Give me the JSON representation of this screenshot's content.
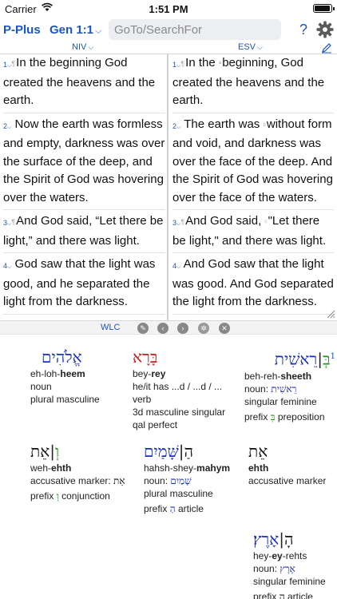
{
  "status": {
    "carrier": "Carrier",
    "time": "1:51 PM",
    "battery_level": 0.95
  },
  "toolbar": {
    "app_name": "P-Plus",
    "reference": "Gen 1:1",
    "search_placeholder": "GoTo/SearchFor",
    "help": "?"
  },
  "versions": {
    "left": "NIV",
    "right": "ESV"
  },
  "niv": [
    {
      "num": "1",
      "text": "In the beginning God created the heavens and the earth."
    },
    {
      "num": "2",
      "text": "Now the earth was formless and empty, darkness was over the surface of the deep, and the Spirit of God was hovering over the waters."
    },
    {
      "num": "3",
      "text": "And God said, “Let there be light,” and there was light."
    },
    {
      "num": "4",
      "text": "God saw that the light was good, and he separated the light from the darkness."
    }
  ],
  "esv": [
    {
      "num": "1",
      "text_a": "In the ",
      "text_b": "beginning, God created the heavens and the earth."
    },
    {
      "num": "2",
      "text_a": "The earth was ",
      "text_b": "without form and void, and darkness was over the face of the deep. And the Spirit of God was hovering over the face of the waters."
    },
    {
      "num": "3",
      "text_a": "And God said, ",
      "text_b": "\"Let there be light,\" and there was light."
    },
    {
      "num": "4",
      "text": "And God saw that the light was good. And God separated the light from the darkness."
    }
  ],
  "interlinear": {
    "version": "WLC",
    "words": [
      {
        "hebrew": "בְּ|רֵאשִׁית",
        "verse_num": "1",
        "translit_pre": "beh-reh-",
        "translit_bold": "sheeth",
        "noun_label": "noun: ",
        "noun_lemma": "רֵאשִׁית",
        "grammar": "singular feminine",
        "prefix_label": "prefix ",
        "prefix_letter": "בְּ",
        "prefix_gloss": "preposition"
      },
      {
        "hebrew": "בָּרָא",
        "translit_pre": "bey-",
        "translit_bold": "rey",
        "gloss": "he/it has ...d / ...d / ...",
        "pos": "verb",
        "grammar": "3d masculine singular",
        "stem": "qal perfect"
      },
      {
        "hebrew": "אֱלֹהִים",
        "translit_pre": "eh-loh-",
        "translit_bold": "heem",
        "pos": "noun",
        "grammar": "plural masculine"
      },
      {
        "hebrew": "אֵת",
        "translit_pre": "",
        "translit_bold": "ehth",
        "pos": "accusative marker"
      },
      {
        "hebrew": "הַ|שָּׁמַיִם",
        "translit_pre": "hahsh-shey-",
        "translit_bold": "mahym",
        "noun_label": "noun: ",
        "noun_lemma": "שָׁמַיִם",
        "grammar": "plural masculine",
        "prefix_label": "prefix ",
        "prefix_letter": "הַ",
        "prefix_gloss": "article"
      },
      {
        "hebrew": "וְ|אֵת",
        "translit_pre": "weh-",
        "translit_bold": "ehth",
        "pos_label": "accusative marker: ",
        "pos_lemma": "אֵת",
        "prefix_label": "prefix ",
        "prefix_letter": "וְ",
        "prefix_gloss": "conjunction"
      },
      {
        "hebrew": "הָ|אָרֶץ׃",
        "translit_pre": "hey-",
        "translit_bold": "ey",
        "translit_post": "-rehts",
        "noun_label": "noun: ",
        "noun_lemma": "אֶרֶץ",
        "grammar": "singular feminine",
        "prefix_label": "prefix ",
        "prefix_letter": "הָ",
        "prefix_gloss": "article"
      }
    ]
  }
}
